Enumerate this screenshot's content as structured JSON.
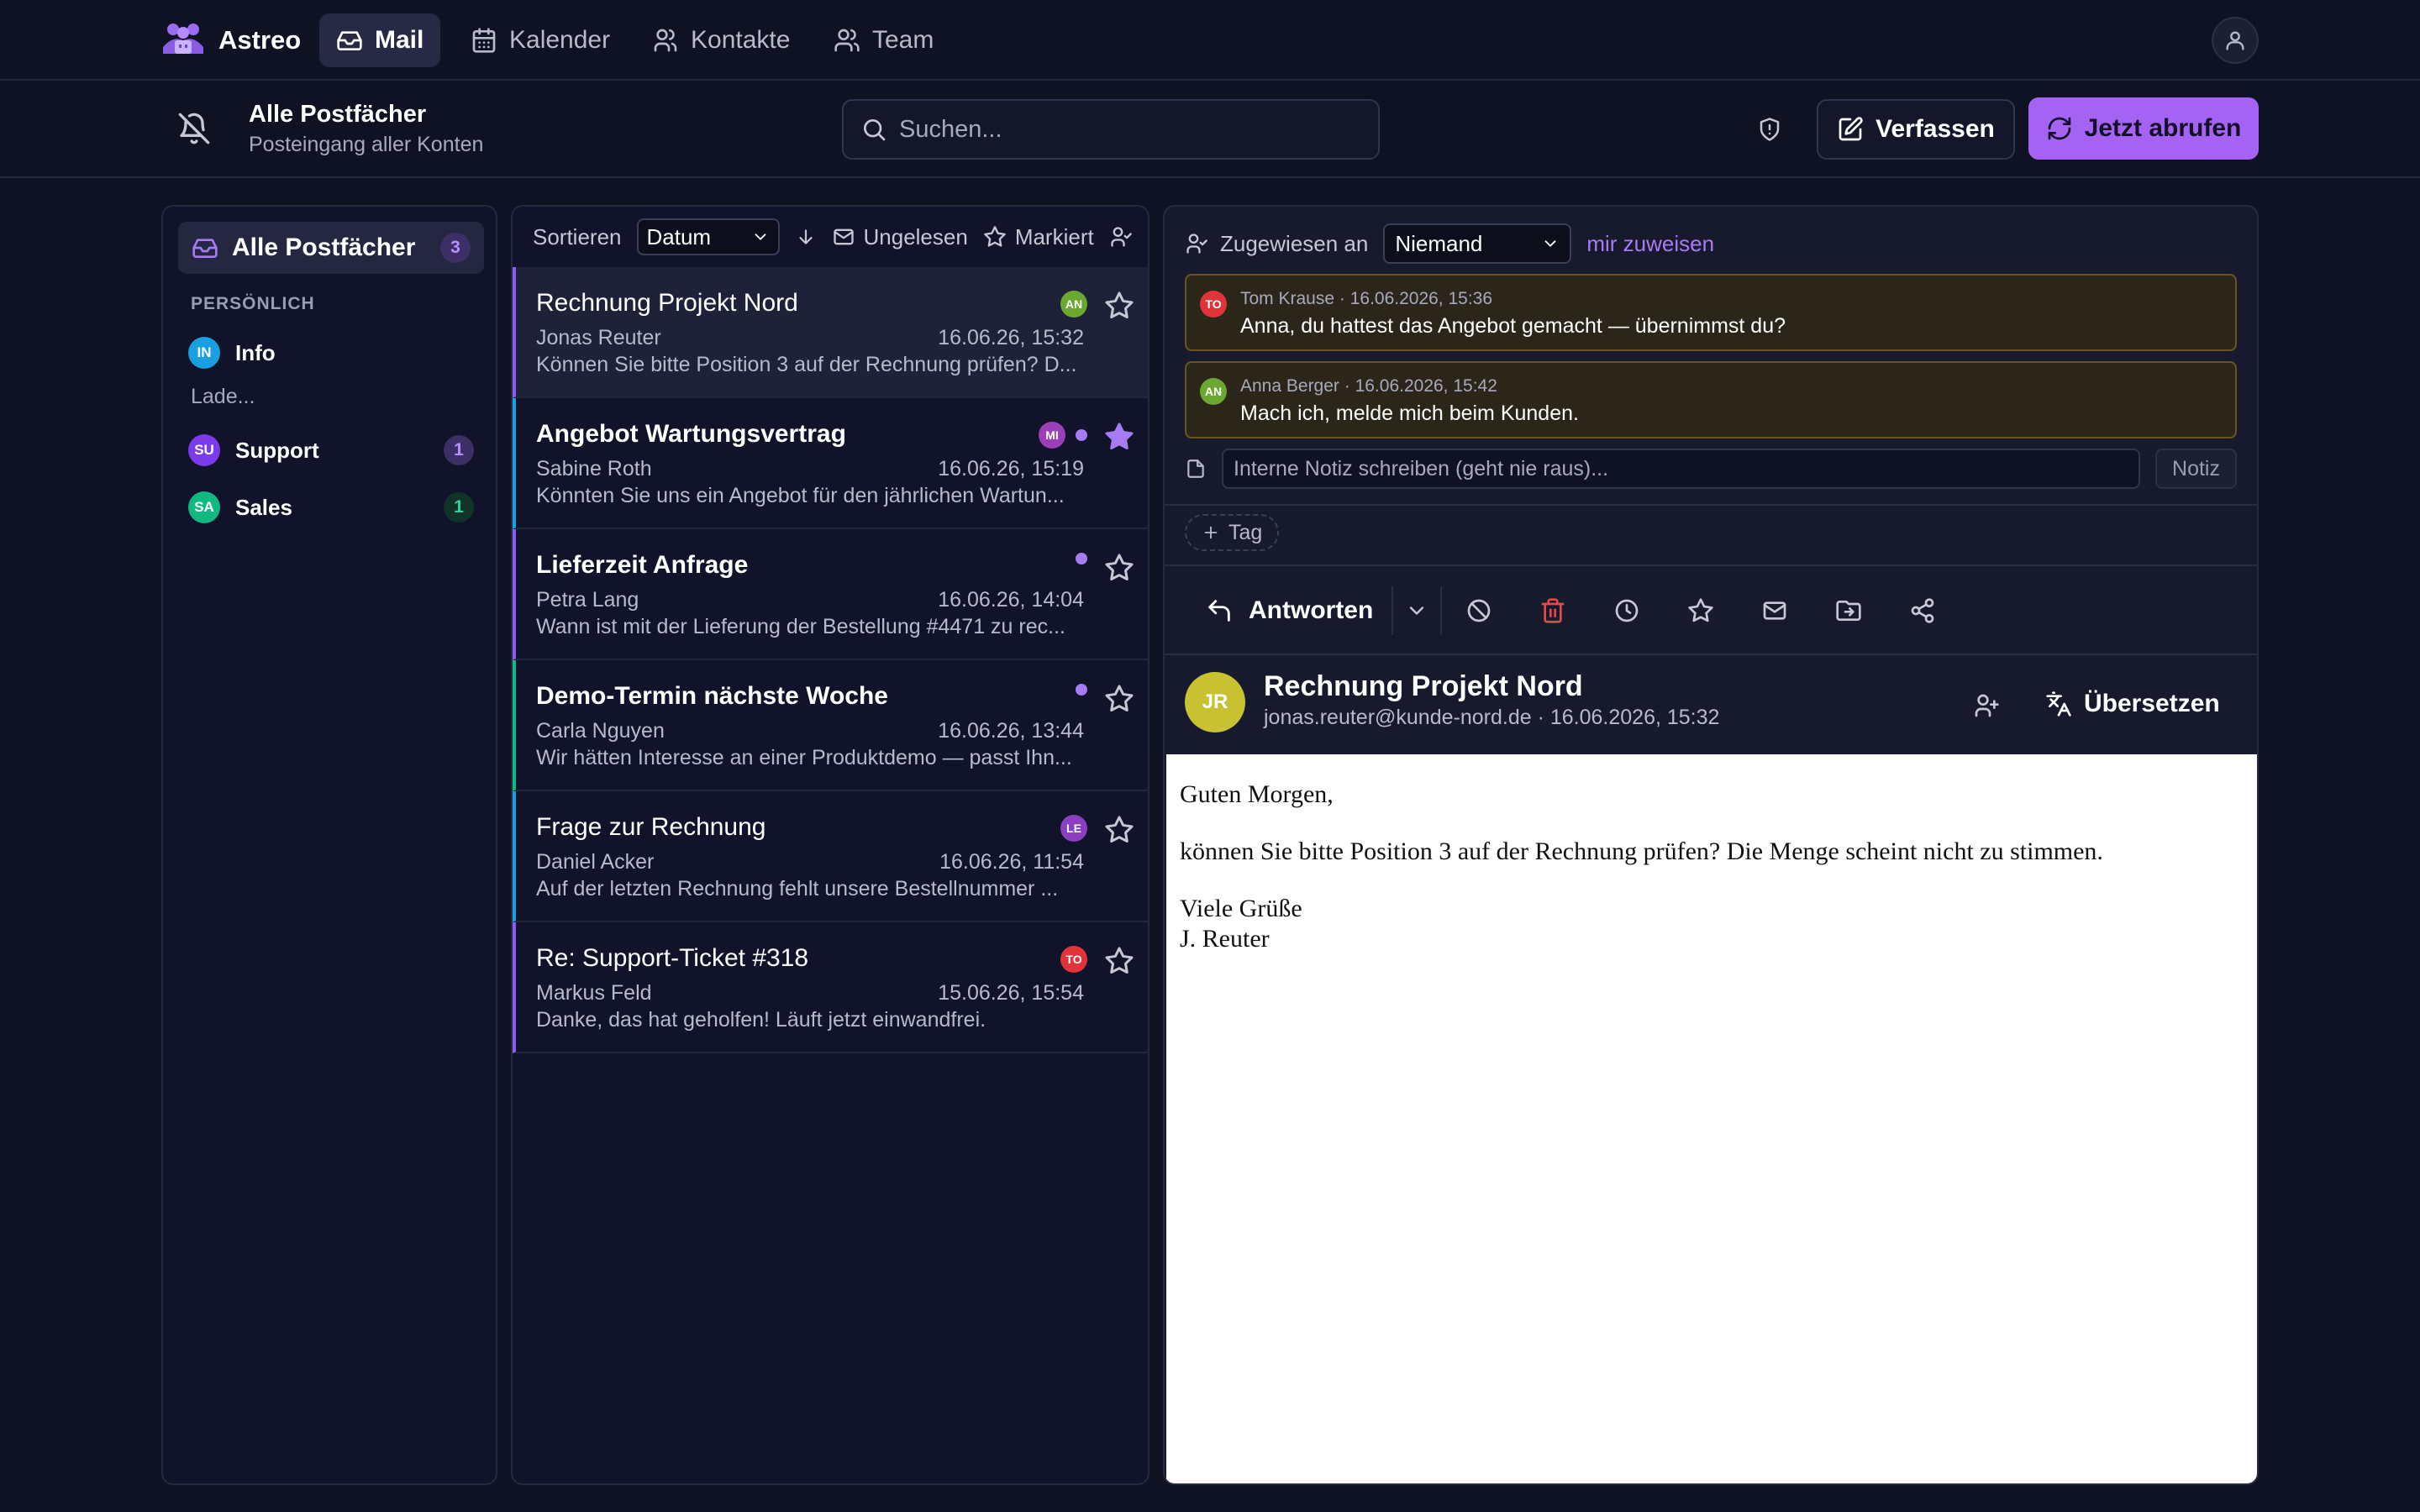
{
  "app": {
    "name": "Astreo",
    "nav": [
      {
        "label": "Mail",
        "icon": "inbox-icon",
        "active": true
      },
      {
        "label": "Kalender",
        "icon": "calendar-icon",
        "active": false
      },
      {
        "label": "Kontakte",
        "icon": "users-icon",
        "active": false
      },
      {
        "label": "Team",
        "icon": "team-icon",
        "active": false
      }
    ]
  },
  "header": {
    "title": "Alle Postfächer",
    "subtitle": "Posteingang aller Konten",
    "search_placeholder": "Suchen...",
    "compose_label": "Verfassen",
    "fetch_label": "Jetzt abrufen"
  },
  "sidebar": {
    "all_label": "Alle Postfächer",
    "all_count": "3",
    "section_label": "PERSÖNLICH",
    "loading": "Lade...",
    "accounts": [
      {
        "initials": "IN",
        "label": "Info",
        "color": "#1a9fe0",
        "count": ""
      },
      {
        "initials": "SU",
        "label": "Support",
        "color": "#7c3aed",
        "count": "1"
      },
      {
        "initials": "SA",
        "label": "Sales",
        "color": "#10b981",
        "count": "1"
      }
    ]
  },
  "list": {
    "sort_label": "Sortieren",
    "sort_value": "Datum",
    "filter_unread": "Ungelesen",
    "filter_flagged": "Markiert",
    "items": [
      {
        "subject": "Rechnung Projekt Nord",
        "sender": "Jonas Reuter",
        "date": "16.06.26, 15:32",
        "preview": "Können Sie bitte Position 3 auf der Rechnung prüfen? D...",
        "badge": "AN",
        "badge_color": "#6aa830",
        "accent": "#8b5cf6",
        "unread": false,
        "dot": false,
        "starred": false
      },
      {
        "subject": "Angebot Wartungsvertrag",
        "sender": "Sabine Roth",
        "date": "16.06.26, 15:19",
        "preview": "Könnten Sie uns ein Angebot für den jährlichen Wartun...",
        "badge": "MI",
        "badge_color": "#9b3fb8",
        "accent": "#1a9fe0",
        "unread": true,
        "dot": true,
        "starred": true
      },
      {
        "subject": "Lieferzeit Anfrage",
        "sender": "Petra Lang",
        "date": "16.06.26, 14:04",
        "preview": "Wann ist mit der Lieferung der Bestellung #4471 zu rec...",
        "badge": "",
        "badge_color": "",
        "accent": "#8b5cf6",
        "unread": true,
        "dot": true,
        "starred": false
      },
      {
        "subject": "Demo-Termin nächste Woche",
        "sender": "Carla Nguyen",
        "date": "16.06.26, 13:44",
        "preview": "Wir hätten Interesse an einer Produktdemo — passt Ihn...",
        "badge": "",
        "badge_color": "",
        "accent": "#10b981",
        "unread": true,
        "dot": true,
        "starred": false
      },
      {
        "subject": "Frage zur Rechnung",
        "sender": "Daniel Acker",
        "date": "16.06.26, 11:54",
        "preview": "Auf der letzten Rechnung fehlt unsere Bestellnummer ...",
        "badge": "LE",
        "badge_color": "#8b3fc0",
        "accent": "#1a9fe0",
        "unread": false,
        "dot": false,
        "starred": false
      },
      {
        "subject": "Re: Support-Ticket #318",
        "sender": "Markus Feld",
        "date": "15.06.26, 15:54",
        "preview": "Danke, das hat geholfen! Läuft jetzt einwandfrei.",
        "badge": "TO",
        "badge_color": "#e0343a",
        "accent": "#8b5cf6",
        "unread": false,
        "dot": false,
        "starred": false
      }
    ]
  },
  "detail": {
    "assign_label": "Zugewiesen an",
    "assign_value": "Niemand",
    "assign_me": "mir zuweisen",
    "comments": [
      {
        "initials": "TO",
        "color": "#e0343a",
        "meta": "Tom Krause · 16.06.2026, 15:36",
        "text": "Anna, du hattest das Angebot gemacht — übernimmst du?"
      },
      {
        "initials": "AN",
        "color": "#6aa830",
        "meta": "Anna Berger · 16.06.2026, 15:42",
        "text": "Mach ich, melde mich beim Kunden."
      }
    ],
    "note_placeholder": "Interne Notiz schreiben (geht nie raus)...",
    "note_button": "Notiz",
    "tag_label": "Tag",
    "reply_label": "Antworten",
    "sender_initials": "JR",
    "subject": "Rechnung Projekt Nord",
    "meta": "jonas.reuter@kunde-nord.de · 16.06.2026, 15:32",
    "translate_label": "Übersetzen",
    "body": [
      "Guten Morgen,",
      "können Sie bitte Position 3 auf der Rechnung prüfen? Die Menge scheint nicht zu stimmen.",
      "Viele Grüße",
      "J. Reuter"
    ]
  }
}
